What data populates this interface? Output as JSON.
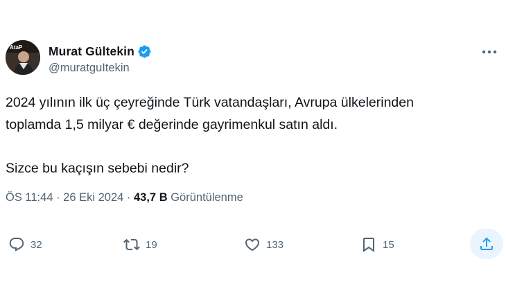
{
  "author": {
    "display_name": "Murat Gültekin",
    "handle": "@muratguItekin",
    "avatar_text": "AtaP",
    "verified_color": "#1d9bf0"
  },
  "tweet": {
    "line1": "2024 yılının ilk üç çeyreğinde Türk vatandaşları, Avrupa ülkelerinden",
    "line2": "toplamda 1,5 milyar € değerinde gayrimenkul satın aldı.",
    "line3": "Sizce bu kaçışın sebebi nedir?"
  },
  "meta": {
    "time": "ÖS 11:44",
    "separator1": " · ",
    "date": "26 Eki 2024",
    "separator2": " · ",
    "views_count": "43,7 B",
    "views_label": "Görüntülenme"
  },
  "actions": {
    "replies": "32",
    "retweets": "19",
    "likes": "133",
    "bookmarks": "15"
  },
  "icons": {
    "more": "more-horizontal-icon",
    "reply": "reply-icon",
    "retweet": "retweet-icon",
    "like": "heart-icon",
    "bookmark": "bookmark-icon",
    "share": "share-icon",
    "verified": "verified-badge-icon"
  },
  "colors": {
    "text_primary": "#0f1419",
    "text_secondary": "#536471",
    "accent": "#1d9bf0",
    "share_bg": "#eaf4fd"
  }
}
